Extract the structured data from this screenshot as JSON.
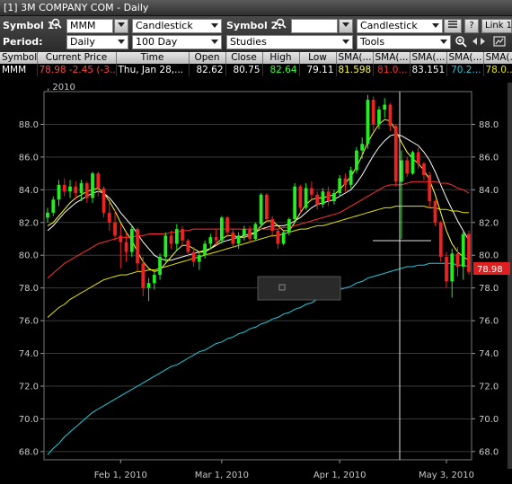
{
  "window": {
    "title": "[1] 3M COMPANY COM - Daily"
  },
  "toolbar": {
    "symbol1_label": "Symbol 1:",
    "symbol1_value": "MMM",
    "chart_type1": "Candlestick",
    "symbol2_label": "Symbol 2:",
    "symbol2_value": "",
    "chart_type2": "Candlestick",
    "help_label": "?",
    "link_label": "Link 1",
    "period_label": "Period:",
    "period_value": "Daily",
    "range_value": "100 Day",
    "studies_value": "Studies",
    "tools_value": "Tools"
  },
  "quote_table": {
    "headers": [
      "Symbol",
      "Current Price",
      "Time",
      "Open",
      "Close",
      "High",
      "Low",
      "SMA(...",
      "SMA(...",
      "SMA(...",
      "SMA(...",
      "SMA(..."
    ],
    "row": [
      "MMM",
      "78.98",
      "-2.45 (-3...",
      "Thu, Jan 28,...",
      "82.62",
      "80.75",
      "82.64",
      "79.11",
      "81.598",
      "81.0...",
      "83.151",
      "70.2...",
      "78.0..."
    ]
  },
  "chart": {
    "year_label": ", 2010",
    "last_price_tag": "78.98",
    "x_labels": [
      "Feb 1, 2010",
      "Mar 1, 2010",
      "Apr 1, 2010",
      "May 3, 2010"
    ],
    "y_labels": [
      "88.0",
      "86.0",
      "84.0",
      "82.0",
      "80.0",
      "78.0",
      "76.0",
      "74.0",
      "72.0",
      "70.0",
      "68.0"
    ]
  },
  "chart_data": {
    "type": "line",
    "y_range": [
      67.5,
      90.0
    ],
    "ticks": [
      88.0,
      86.0,
      84.0,
      82.0,
      80.0,
      78.0,
      76.0,
      74.0,
      72.0,
      70.0,
      68.0
    ],
    "candles": [
      [
        82.3,
        82.9,
        82.0,
        82.6
      ],
      [
        82.6,
        83.6,
        82.4,
        83.4
      ],
      [
        83.4,
        84.6,
        83.0,
        84.3
      ],
      [
        84.3,
        84.7,
        83.6,
        83.9
      ],
      [
        83.9,
        84.6,
        83.5,
        84.2
      ],
      [
        84.2,
        84.5,
        83.4,
        83.8
      ],
      [
        83.8,
        84.6,
        83.3,
        84.4
      ],
      [
        84.4,
        84.5,
        83.2,
        83.5
      ],
      [
        83.5,
        85.1,
        83.2,
        85.0
      ],
      [
        85.0,
        85.1,
        83.6,
        84.1
      ],
      [
        84.1,
        84.2,
        82.3,
        82.6
      ],
      [
        82.6,
        83.2,
        81.5,
        82.0
      ],
      [
        82.0,
        82.8,
        80.9,
        81.2
      ],
      [
        81.2,
        81.9,
        79.2,
        80.8
      ],
      [
        80.8,
        81.4,
        79.6,
        80.2
      ],
      [
        80.2,
        81.8,
        79.9,
        81.6
      ],
      [
        81.6,
        81.7,
        79.0,
        79.5
      ],
      [
        79.5,
        79.9,
        77.5,
        78.0
      ],
      [
        78.0,
        78.6,
        77.2,
        78.3
      ],
      [
        78.3,
        79.0,
        77.9,
        78.8
      ],
      [
        78.8,
        80.1,
        78.5,
        79.9
      ],
      [
        79.9,
        81.4,
        79.6,
        81.2
      ],
      [
        81.2,
        81.5,
        80.4,
        80.7
      ],
      [
        80.7,
        81.9,
        80.3,
        81.6
      ],
      [
        81.6,
        81.8,
        80.6,
        80.9
      ],
      [
        80.9,
        81.0,
        79.9,
        80.2
      ],
      [
        80.2,
        80.5,
        79.3,
        79.6
      ],
      [
        79.6,
        80.2,
        79.1,
        80.0
      ],
      [
        80.0,
        80.9,
        79.8,
        80.7
      ],
      [
        80.7,
        81.3,
        80.4,
        81.1
      ],
      [
        81.1,
        81.6,
        80.6,
        80.9
      ],
      [
        80.9,
        82.4,
        80.7,
        82.3
      ],
      [
        82.3,
        82.4,
        81.1,
        81.4
      ],
      [
        81.4,
        81.6,
        80.5,
        80.7
      ],
      [
        80.7,
        81.4,
        80.4,
        81.2
      ],
      [
        81.2,
        81.8,
        80.9,
        81.6
      ],
      [
        81.6,
        81.8,
        80.8,
        81.0
      ],
      [
        81.0,
        82.0,
        80.9,
        81.9
      ],
      [
        81.9,
        83.8,
        81.7,
        83.7
      ],
      [
        83.7,
        83.8,
        82.0,
        82.2
      ],
      [
        82.2,
        82.4,
        81.1,
        81.5
      ],
      [
        81.5,
        81.6,
        80.4,
        80.7
      ],
      [
        80.7,
        81.5,
        80.6,
        81.4
      ],
      [
        81.4,
        82.3,
        81.2,
        82.2
      ],
      [
        82.2,
        84.4,
        82.0,
        84.2
      ],
      [
        84.2,
        84.3,
        82.6,
        82.9
      ],
      [
        82.9,
        84.4,
        82.8,
        84.1
      ],
      [
        84.1,
        84.5,
        83.4,
        83.7
      ],
      [
        83.7,
        83.9,
        82.8,
        83.1
      ],
      [
        83.1,
        84.1,
        82.9,
        83.9
      ],
      [
        83.9,
        84.2,
        83.0,
        83.3
      ],
      [
        83.3,
        84.0,
        83.1,
        83.8
      ],
      [
        83.8,
        84.9,
        83.6,
        84.7
      ],
      [
        84.7,
        85.0,
        83.9,
        84.3
      ],
      [
        84.3,
        85.4,
        84.1,
        85.2
      ],
      [
        85.2,
        86.6,
        85.0,
        86.4
      ],
      [
        86.4,
        87.2,
        85.9,
        86.8
      ],
      [
        86.8,
        89.8,
        86.5,
        89.5
      ],
      [
        89.5,
        89.7,
        87.6,
        88.0
      ],
      [
        88.0,
        89.1,
        87.7,
        88.9
      ],
      [
        88.9,
        89.6,
        88.4,
        89.2
      ],
      [
        89.2,
        89.3,
        87.6,
        87.9
      ],
      [
        87.9,
        88.0,
        84.2,
        84.5
      ],
      [
        84.5,
        86.4,
        81.0,
        85.8
      ],
      [
        85.8,
        86.0,
        84.8,
        85.0
      ],
      [
        85.0,
        86.4,
        84.9,
        86.3
      ],
      [
        86.3,
        86.6,
        85.3,
        85.6
      ],
      [
        85.6,
        85.7,
        84.6,
        84.9
      ],
      [
        84.9,
        85.1,
        82.9,
        83.3
      ],
      [
        83.3,
        83.4,
        81.8,
        82.0
      ],
      [
        82.0,
        82.1,
        79.6,
        79.9
      ],
      [
        79.9,
        80.2,
        78.0,
        78.4
      ],
      [
        78.4,
        80.4,
        77.4,
        80.1
      ],
      [
        80.1,
        80.5,
        78.7,
        79.3
      ],
      [
        79.3,
        81.5,
        78.5,
        81.3
      ],
      [
        81.3,
        81.5,
        78.8,
        78.98
      ]
    ],
    "overlays": [
      {
        "color": "#ffffff",
        "values": [
          81.5,
          81.8,
          82.2,
          82.6,
          82.9,
          83.2,
          83.4,
          83.6,
          83.8,
          83.9,
          83.8,
          83.5,
          83.1,
          82.6,
          82.2,
          81.8,
          81.3,
          80.8,
          80.4,
          80.0,
          79.8,
          79.7,
          79.7,
          79.8,
          79.9,
          80.0,
          80.1,
          80.2,
          80.3,
          80.4,
          80.6,
          80.8,
          80.9,
          81.0,
          81.1,
          81.2,
          81.3,
          81.4,
          81.6,
          81.7,
          81.8,
          81.8,
          81.8,
          81.9,
          82.1,
          82.3,
          82.6,
          82.9,
          83.1,
          83.2,
          83.3,
          83.4,
          83.6,
          83.8,
          84.0,
          84.4,
          84.9,
          85.5,
          86.1,
          86.6,
          87.0,
          87.3,
          87.4,
          87.3,
          87.1,
          86.9,
          86.7,
          86.3,
          85.8,
          85.1,
          84.3,
          83.5,
          82.8,
          82.1,
          81.5,
          80.9
        ]
      },
      {
        "color": "#ffff33",
        "values": [
          81.8,
          82.0,
          82.4,
          82.8,
          83.2,
          83.5,
          83.7,
          83.9,
          84.0,
          84.1,
          83.8,
          83.3,
          82.7,
          82.0,
          81.4,
          80.9,
          80.2,
          79.6,
          79.2,
          79.0,
          79.1,
          79.5,
          79.9,
          80.3,
          80.6,
          80.6,
          80.4,
          80.2,
          80.2,
          80.4,
          80.7,
          81.0,
          81.2,
          81.2,
          81.1,
          81.1,
          81.2,
          81.4,
          81.8,
          82.1,
          82.1,
          81.8,
          81.5,
          81.5,
          82.0,
          82.6,
          83.1,
          83.4,
          83.5,
          83.5,
          83.6,
          83.7,
          84.0,
          84.4,
          84.8,
          85.4,
          86.1,
          86.9,
          87.5,
          88.0,
          88.3,
          88.2,
          87.6,
          86.9,
          86.3,
          85.9,
          85.6,
          85.2,
          84.6,
          83.7,
          82.6,
          81.5,
          80.7,
          80.2,
          79.9,
          79.7
        ]
      },
      {
        "color": "#ff3333",
        "values": [
          78.6,
          78.9,
          79.2,
          79.5,
          79.7,
          79.9,
          80.1,
          80.3,
          80.5,
          80.7,
          80.8,
          80.9,
          81.0,
          81.1,
          81.1,
          81.1,
          81.2,
          81.2,
          81.3,
          81.3,
          81.3,
          81.3,
          81.4,
          81.4,
          81.5,
          81.5,
          81.6,
          81.6,
          81.6,
          81.6,
          81.6,
          81.6,
          81.6,
          81.6,
          81.6,
          81.6,
          81.6,
          81.6,
          81.6,
          81.6,
          81.6,
          81.6,
          81.7,
          81.7,
          81.8,
          81.9,
          82.0,
          82.1,
          82.2,
          82.3,
          82.4,
          82.5,
          82.6,
          82.8,
          83.0,
          83.2,
          83.4,
          83.6,
          83.8,
          84.0,
          84.2,
          84.3,
          84.3,
          84.3,
          84.4,
          84.5,
          84.5,
          84.5,
          84.5,
          84.5,
          84.4,
          84.4,
          84.3,
          84.1,
          84.0,
          83.8
        ]
      },
      {
        "color": "#e6e600",
        "values": [
          76.2,
          76.5,
          76.8,
          77.0,
          77.3,
          77.5,
          77.7,
          77.9,
          78.1,
          78.3,
          78.5,
          78.6,
          78.7,
          78.8,
          78.8,
          78.9,
          79.0,
          79.0,
          79.1,
          79.1,
          79.2,
          79.3,
          79.4,
          79.5,
          79.6,
          79.7,
          79.8,
          79.9,
          80.0,
          80.1,
          80.2,
          80.3,
          80.4,
          80.5,
          80.6,
          80.7,
          80.8,
          80.9,
          81.0,
          81.1,
          81.2,
          81.2,
          81.3,
          81.4,
          81.5,
          81.6,
          81.6,
          81.7,
          81.8,
          81.8,
          81.9,
          82.0,
          82.1,
          82.2,
          82.3,
          82.4,
          82.5,
          82.6,
          82.7,
          82.8,
          82.9,
          82.9,
          83.0,
          83.0,
          83.0,
          83.0,
          83.0,
          83.0,
          82.9,
          82.9,
          82.8,
          82.8,
          82.7,
          82.7,
          82.6,
          82.6
        ]
      },
      {
        "color": "#22ccdd",
        "values": [
          67.8,
          68.2,
          68.5,
          68.9,
          69.2,
          69.5,
          69.8,
          70.1,
          70.4,
          70.6,
          70.8,
          71.0,
          71.2,
          71.4,
          71.6,
          71.8,
          72.0,
          72.2,
          72.4,
          72.6,
          72.8,
          73.0,
          73.2,
          73.3,
          73.5,
          73.7,
          73.9,
          74.1,
          74.2,
          74.4,
          74.6,
          74.7,
          74.9,
          75.0,
          75.2,
          75.3,
          75.5,
          75.6,
          75.8,
          75.9,
          76.1,
          76.2,
          76.4,
          76.5,
          76.7,
          76.8,
          77.0,
          77.1,
          77.3,
          77.4,
          77.6,
          77.7,
          77.9,
          78.0,
          78.1,
          78.3,
          78.4,
          78.6,
          78.7,
          78.8,
          78.9,
          79.0,
          79.1,
          79.2,
          79.3,
          79.3,
          79.4,
          79.4,
          79.5,
          79.5,
          79.5,
          79.5,
          79.5,
          79.4,
          79.4,
          79.3
        ]
      }
    ]
  }
}
